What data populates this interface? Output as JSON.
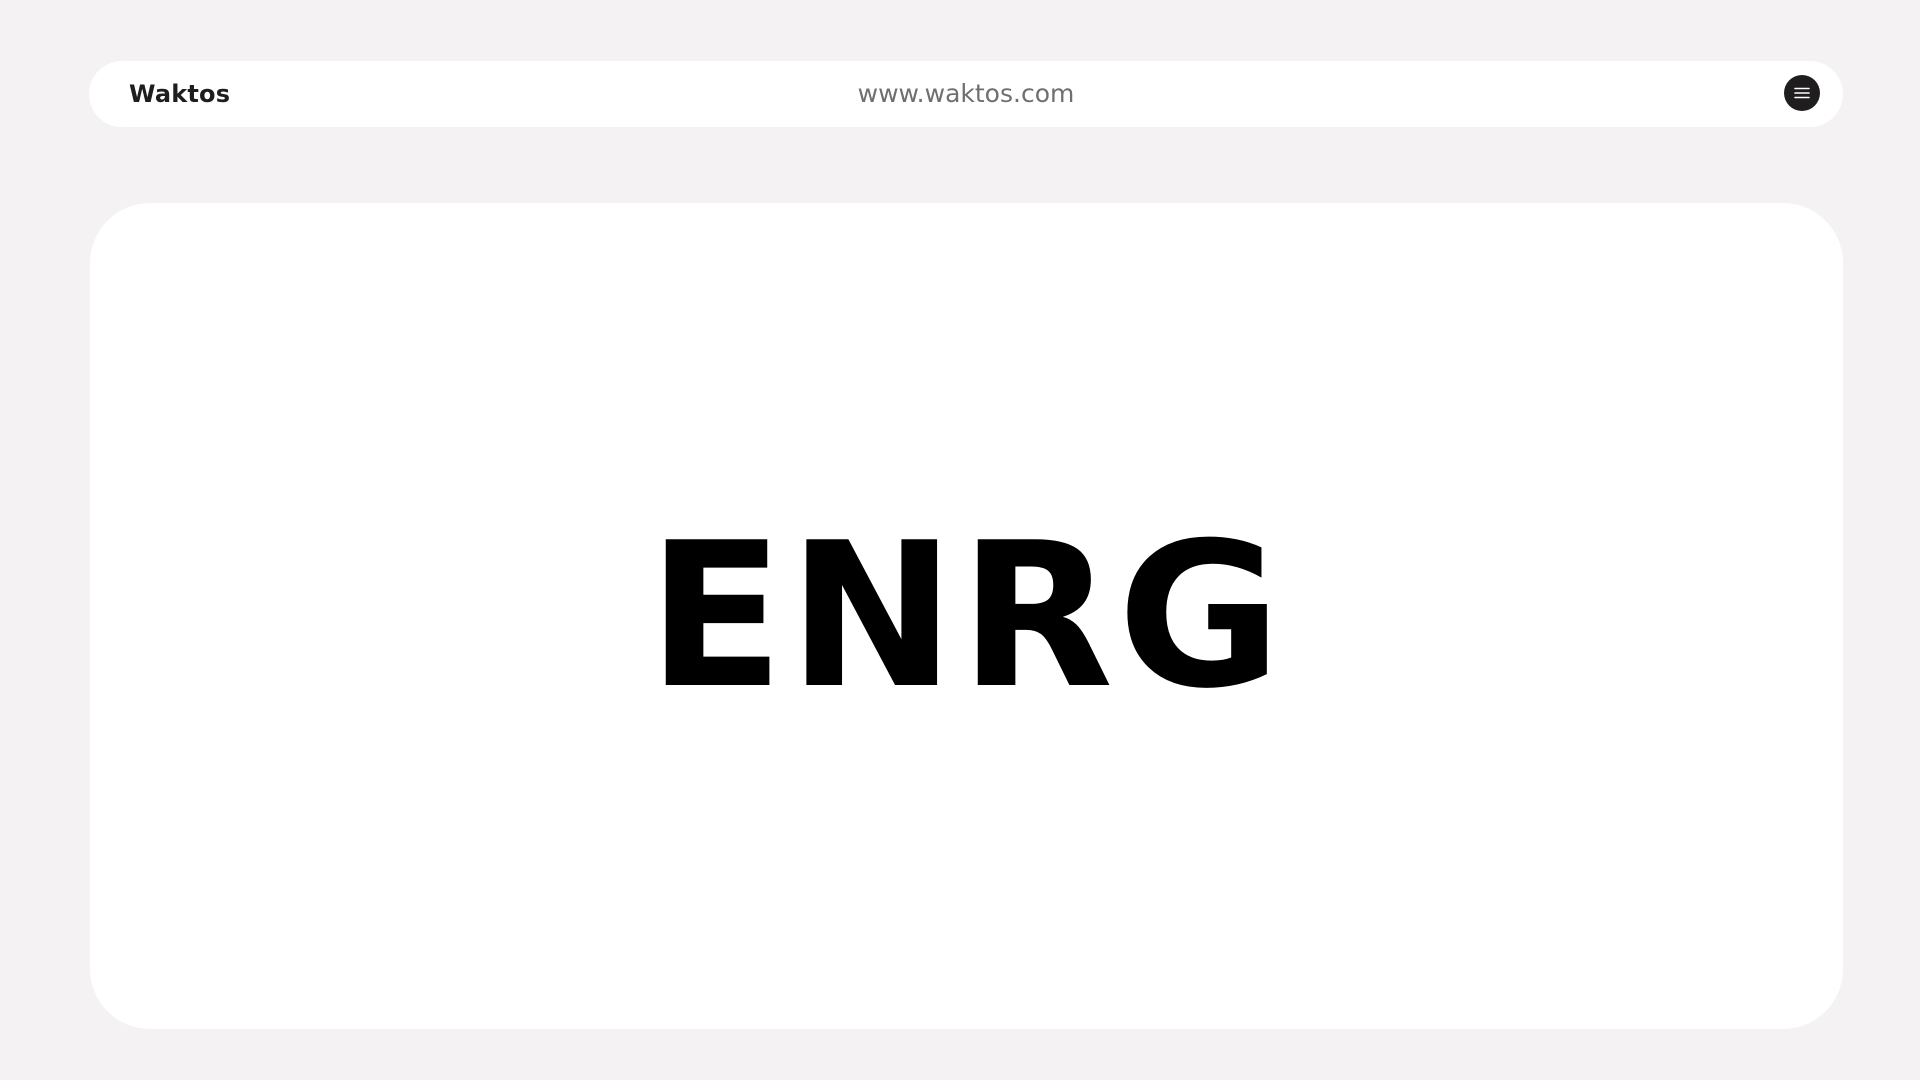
{
  "header": {
    "brand": "Waktos",
    "url": "www.waktos.com",
    "menu_icon": "hamburger-menu-icon"
  },
  "main": {
    "headline": "ENRG"
  },
  "colors": {
    "background": "#f4f2f3",
    "surface": "#ffffff",
    "brand_text": "#1e1e1e",
    "url_text": "#6f6f6f",
    "menu_button": "#1f1d1e",
    "headline": "#000000"
  }
}
